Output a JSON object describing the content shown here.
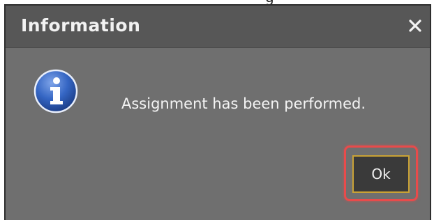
{
  "dialog": {
    "title": "Information",
    "close_icon": "close-icon",
    "message": "Assignment has been performed.",
    "icon": "info-icon",
    "ok_label": "Ok"
  },
  "background_fragment": {
    "text": "g"
  },
  "colors": {
    "dialog_bg": "#6f6f6f",
    "titlebar_bg": "#575757",
    "button_bg": "#3a3a3a",
    "button_border": "#c9a235",
    "highlight": "#e84b4b",
    "info_blue": "#2f5fb7"
  }
}
